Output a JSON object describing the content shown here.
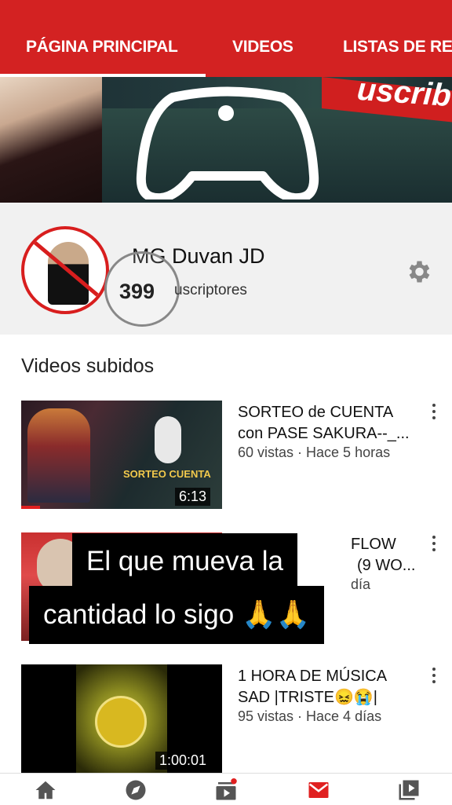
{
  "tabs": [
    {
      "label": "PÁGINA PRINCIPAL",
      "active": true
    },
    {
      "label": "VIDEOS",
      "active": false
    },
    {
      "label": "LISTAS DE RE",
      "active": false
    }
  ],
  "banner": {
    "overlay_text": "uscrib"
  },
  "channel": {
    "name": "MG Duvan JD",
    "subscriber_count": "399",
    "subscriber_label": "uscriptores"
  },
  "section_title": "Videos subidos",
  "videos": [
    {
      "title_line1": "SORTEO de CUENTA",
      "title_line2": "con PASE SAKURA--_...",
      "meta": "60 vistas · Hace 5 horas",
      "duration": "6:13",
      "thumb_text": "SORTEO CUENTA"
    },
    {
      "title_line1": "FLOW",
      "title_line2": "(9 WO...",
      "meta": "día",
      "duration": ""
    },
    {
      "title_line1": "1 HORA DE MÚSICA",
      "title_line2": "SAD |TRISTE😖😭|",
      "meta": "95 vistas · Hace 4 días",
      "duration": "1:00:01"
    }
  ],
  "caption": {
    "line1": "El que mueva la",
    "line2": "cantidad lo sigo 🙏🙏"
  },
  "bottom_nav": [
    "home-icon",
    "explore-icon",
    "subscriptions-icon",
    "inbox-icon",
    "library-icon"
  ],
  "colors": {
    "brand_red": "#d32222",
    "nav_red": "#e02020"
  }
}
